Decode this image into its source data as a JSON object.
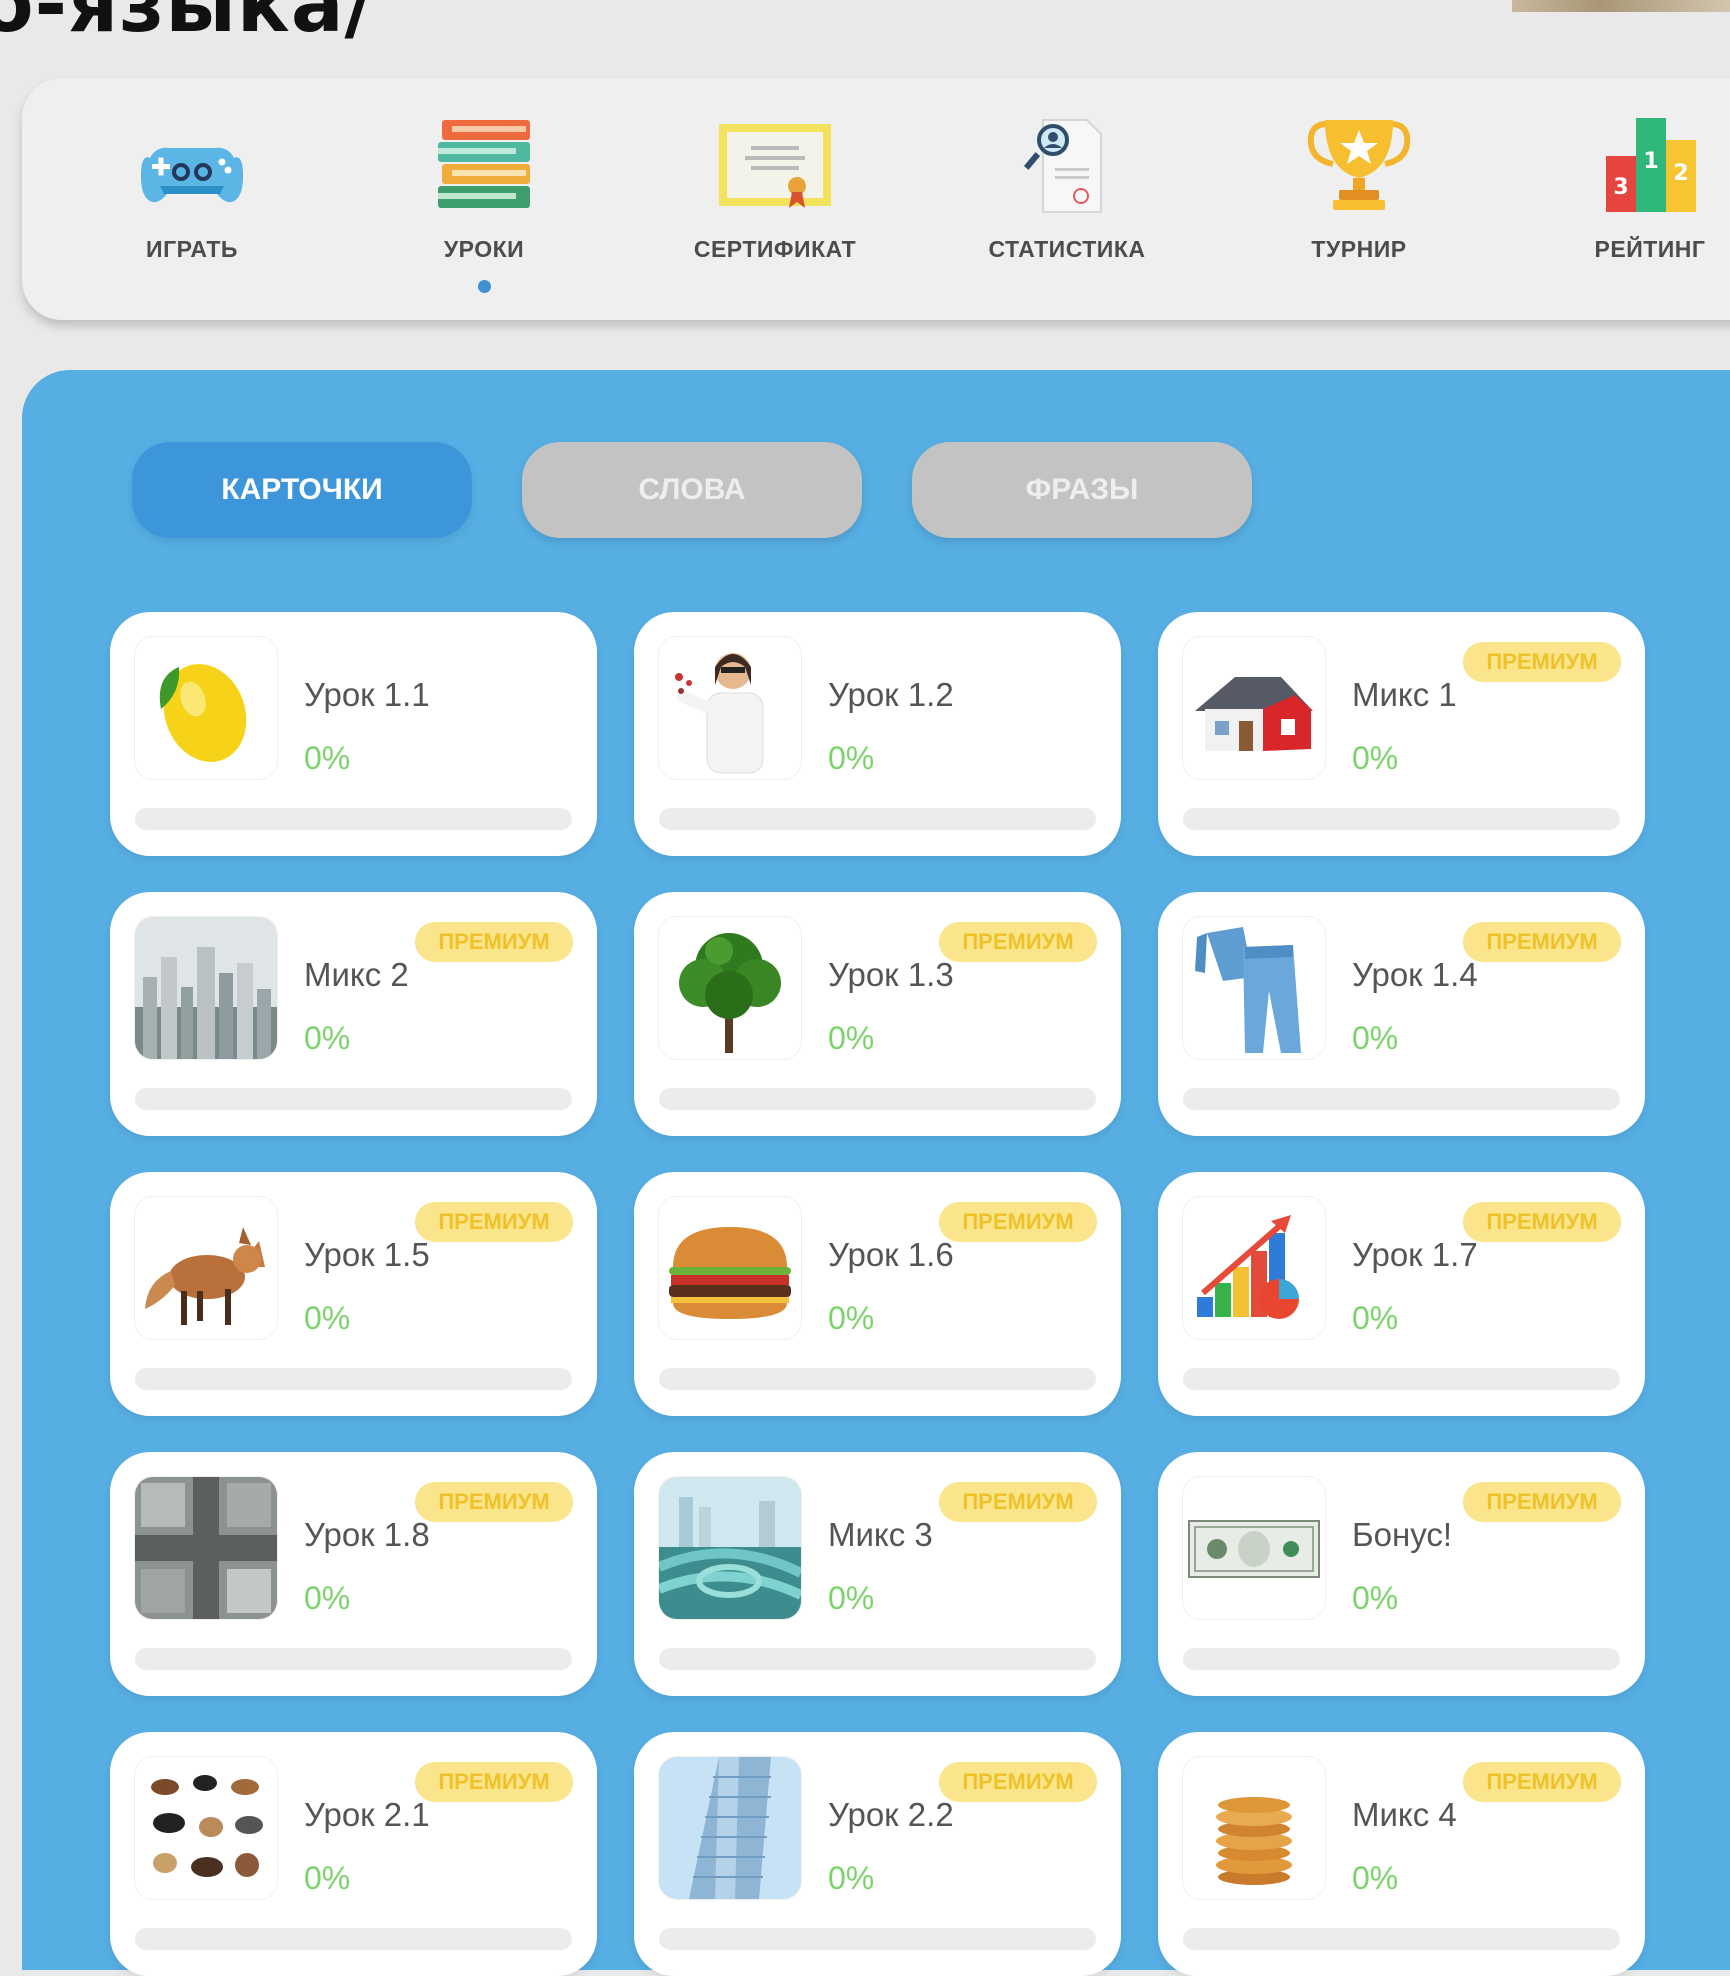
{
  "page": {
    "heading": "о-языка/"
  },
  "nav": [
    {
      "label": "ИГРАТЬ",
      "icon": "gamepad-icon",
      "active": false
    },
    {
      "label": "УРОКИ",
      "icon": "books-icon",
      "active": true
    },
    {
      "label": "СЕРТИФИКАТ",
      "icon": "certificate-icon",
      "active": false
    },
    {
      "label": "СТАТИСТИКА",
      "icon": "statistics-icon",
      "active": false
    },
    {
      "label": "ТУРНИР",
      "icon": "trophy-icon",
      "active": false
    },
    {
      "label": "РЕЙТИНГ",
      "icon": "podium-icon",
      "active": false
    }
  ],
  "podium_numbers": [
    "3",
    "1",
    "2"
  ],
  "tabs": [
    {
      "label": "КАРТОЧКИ",
      "active": true
    },
    {
      "label": "СЛОВА",
      "active": false
    },
    {
      "label": "ФРАЗЫ",
      "active": false
    }
  ],
  "lessons": [
    {
      "title": "Урок 1.1",
      "progress": "0%",
      "progress_value": 0,
      "premium": false,
      "image": "lemon-icon"
    },
    {
      "title": "Урок 1.2",
      "progress": "0%",
      "progress_value": 0,
      "premium": false,
      "image": "scientist-icon"
    },
    {
      "title": "Микс 1",
      "progress": "0%",
      "progress_value": 0,
      "premium": true,
      "image": "house-icon"
    },
    {
      "title": "Микс 2",
      "progress": "0%",
      "progress_value": 0,
      "premium": true,
      "image": "city-icon"
    },
    {
      "title": "Урок 1.3",
      "progress": "0%",
      "progress_value": 0,
      "premium": true,
      "image": "tree-icon"
    },
    {
      "title": "Урок 1.4",
      "progress": "0%",
      "progress_value": 0,
      "premium": true,
      "image": "pajamas-icon"
    },
    {
      "title": "Урок 1.5",
      "progress": "0%",
      "progress_value": 0,
      "premium": true,
      "image": "fox-icon"
    },
    {
      "title": "Урок 1.6",
      "progress": "0%",
      "progress_value": 0,
      "premium": true,
      "image": "burger-icon"
    },
    {
      "title": "Урок 1.7",
      "progress": "0%",
      "progress_value": 0,
      "premium": true,
      "image": "growth-chart-icon"
    },
    {
      "title": "Урок 1.8",
      "progress": "0%",
      "progress_value": 0,
      "premium": true,
      "image": "crossroads-icon"
    },
    {
      "title": "Микс 3",
      "progress": "0%",
      "progress_value": 0,
      "premium": true,
      "image": "highway-icon"
    },
    {
      "title": "Бонус!",
      "progress": "0%",
      "progress_value": 0,
      "premium": true,
      "image": "banknote-icon"
    },
    {
      "title": "Урок 2.1",
      "progress": "0%",
      "progress_value": 0,
      "premium": true,
      "image": "animals-icon"
    },
    {
      "title": "Урок 2.2",
      "progress": "0%",
      "progress_value": 0,
      "premium": true,
      "image": "skyscraper-icon"
    },
    {
      "title": "Микс 4",
      "progress": "0%",
      "progress_value": 0,
      "premium": true,
      "image": "pancakes-icon"
    }
  ],
  "premium_label": "ПРЕМИУМ",
  "colors": {
    "nav_background": "#efefef",
    "panel_blue": "#56aee3",
    "active_tab": "#3d96d9",
    "inactive_tab": "#c3c3c3",
    "progress_green": "#7cd36b",
    "premium_badge_bg": "#fbe58c",
    "premium_badge_text": "#f0c22a"
  }
}
